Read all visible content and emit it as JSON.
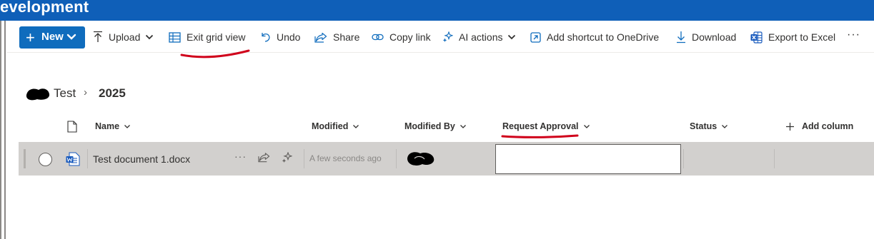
{
  "window": {
    "title": "evelopment",
    "accent": "#0f5fb8"
  },
  "toolbar": {
    "new_label": "New",
    "commands": [
      {
        "id": "upload",
        "label": "Upload",
        "icon": "upload-arrow-icon",
        "has_dropdown": true
      },
      {
        "id": "exit-grid",
        "label": "Exit grid view",
        "icon": "grid-table-icon",
        "has_dropdown": false
      },
      {
        "id": "undo",
        "label": "Undo",
        "icon": "undo-icon",
        "has_dropdown": false
      },
      {
        "id": "share",
        "label": "Share",
        "icon": "share-icon",
        "has_dropdown": false
      },
      {
        "id": "copy-link",
        "label": "Copy link",
        "icon": "link-icon",
        "has_dropdown": false
      },
      {
        "id": "ai-actions",
        "label": "AI actions",
        "icon": "sparkle-icon",
        "has_dropdown": true
      },
      {
        "id": "add-shortcut",
        "label": "Add shortcut to OneDrive",
        "icon": "shortcut-icon",
        "has_dropdown": false
      },
      {
        "id": "download",
        "label": "Download",
        "icon": "download-icon",
        "has_dropdown": false
      },
      {
        "id": "export-excel",
        "label": "Export to Excel",
        "icon": "excel-icon",
        "has_dropdown": false
      }
    ],
    "more_label": "···"
  },
  "breadcrumb": {
    "root": "Test",
    "separator": "›",
    "current": "2025"
  },
  "columns": {
    "name": "Name",
    "modified": "Modified",
    "modified_by": "Modified By",
    "request_approval": "Request Approval",
    "status": "Status",
    "add_column": "Add column"
  },
  "rows": [
    {
      "file_name": "Test document 1.docx",
      "file_icon": "word-doc-icon",
      "modified": "A few seconds ago",
      "request_approval": "",
      "status": ""
    }
  ],
  "row_actions": {
    "more": "···"
  },
  "annotation_color": "#d0021b"
}
